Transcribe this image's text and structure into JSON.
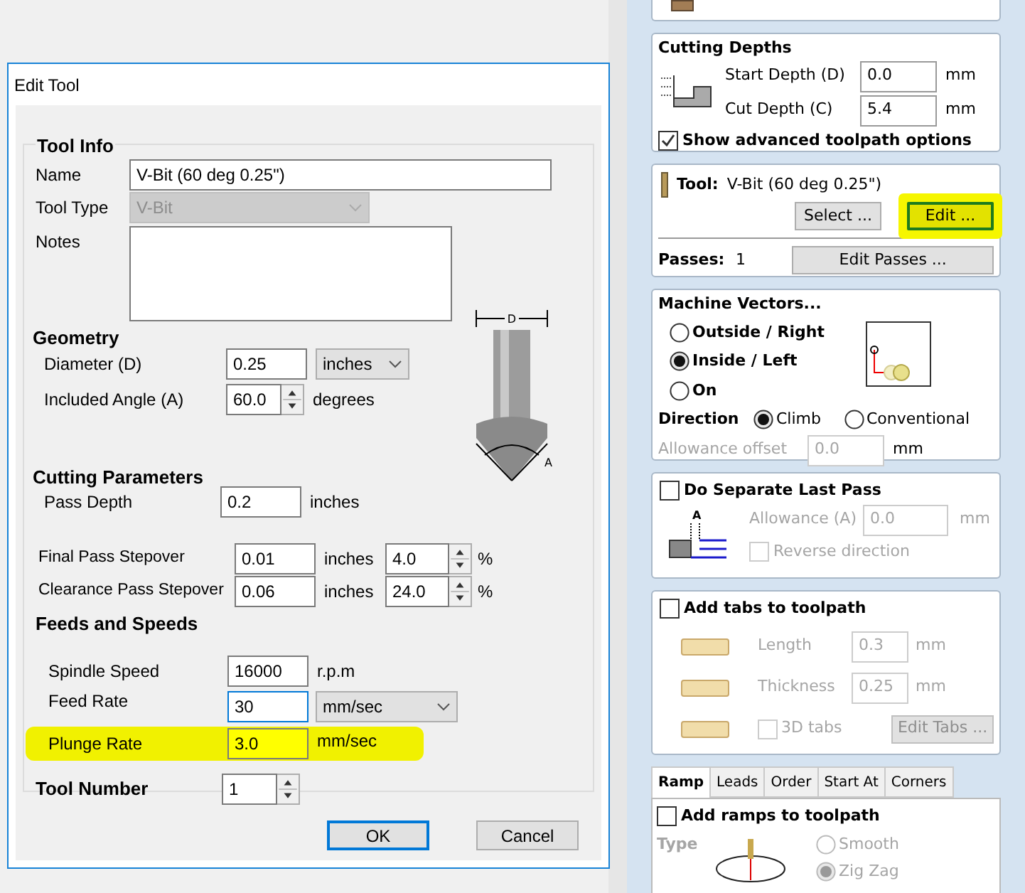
{
  "dialog": {
    "title": "Edit Tool",
    "group_title": "Tool Info",
    "name": {
      "label": "Name",
      "value": "V-Bit (60 deg 0.25\")"
    },
    "tool_type": {
      "label": "Tool Type",
      "value": "V-Bit",
      "disabled": true
    },
    "notes": {
      "label": "Notes"
    },
    "geometry": {
      "heading": "Geometry",
      "diameter": {
        "label": "Diameter (D)",
        "value": "0.25",
        "unit": "inches"
      },
      "angle": {
        "label": "Included Angle (A)",
        "value": "60.0",
        "unit": "degrees"
      }
    },
    "tool_diagram": {
      "diameter_mark": "D",
      "angle_mark": "A"
    },
    "cutting": {
      "heading": "Cutting Parameters",
      "pass_depth": {
        "label": "Pass Depth",
        "value": "0.2",
        "unit": "inches"
      },
      "stepovers": [
        {
          "label": "Final Pass Stepover",
          "value": "0.01",
          "unit": "inches",
          "percent": "4.0",
          "percent_unit": "%"
        },
        {
          "label": "Clearance Pass Stepover",
          "value": "0.06",
          "unit": "inches",
          "percent": "24.0",
          "percent_unit": "%"
        }
      ]
    },
    "feeds": {
      "heading": "Feeds and Speeds",
      "spindle": {
        "label": "Spindle Speed",
        "value": "16000",
        "unit": "r.p.m"
      },
      "feed": {
        "label": "Feed Rate",
        "value": "30",
        "unit": "mm/sec",
        "focused": true
      },
      "plunge": {
        "label": "Plunge Rate",
        "value": "3.0",
        "unit": "mm/sec",
        "highlighted": true
      }
    },
    "tool_number": {
      "label": "Tool Number",
      "value": "1"
    },
    "buttons": [
      {
        "label": "OK",
        "default": true
      },
      {
        "label": "Cancel",
        "default": false
      }
    ]
  },
  "panel": {
    "cutting_depths": {
      "title": "Cutting Depths",
      "start": {
        "label": "Start Depth (D)",
        "value": "0.0",
        "unit": "mm"
      },
      "cut": {
        "label": "Cut Depth (C)",
        "value": "5.4",
        "unit": "mm"
      },
      "show_advanced": {
        "label": "Show advanced toolpath options",
        "checked": true
      }
    },
    "tool": {
      "label": "Tool:",
      "value": "V-Bit (60 deg 0.25\")",
      "buttons": [
        {
          "label": "Select ...",
          "highlighted": false
        },
        {
          "label": "Edit ...",
          "highlighted": true
        }
      ],
      "passes_label": "Passes:",
      "passes_value": "1",
      "edit_passes": "Edit Passes ..."
    },
    "machine_vectors": {
      "title": "Machine Vectors...",
      "sides": [
        {
          "label": "Outside / Right",
          "selected": false
        },
        {
          "label": "Inside / Left",
          "selected": true
        },
        {
          "label": "On",
          "selected": false
        }
      ],
      "direction_label": "Direction",
      "directions": [
        {
          "label": "Climb",
          "selected": true
        },
        {
          "label": "Conventional",
          "selected": false
        }
      ],
      "allowance": {
        "label": "Allowance offset",
        "value": "0.0",
        "unit": "mm",
        "disabled": true
      }
    },
    "last_pass": {
      "label": "Do Separate Last Pass",
      "checked": false,
      "diagram_mark": "A",
      "allowance": {
        "label": "Allowance (A)",
        "value": "0.0",
        "unit": "mm"
      },
      "reverse": {
        "label": "Reverse direction",
        "checked": false
      }
    },
    "tabs": {
      "label": "Add tabs to toolpath",
      "checked": false,
      "length": {
        "label": "Length",
        "value": "0.3",
        "unit": "mm"
      },
      "thickness": {
        "label": "Thickness",
        "value": "0.25",
        "unit": "mm"
      },
      "tabs_3d": {
        "label": "3D tabs",
        "checked": false
      },
      "edit_button": "Edit Tabs ..."
    },
    "option_tabs": [
      {
        "label": "Ramp",
        "selected": true
      },
      {
        "label": "Leads",
        "selected": false
      },
      {
        "label": "Order",
        "selected": false
      },
      {
        "label": "Start At",
        "selected": false
      },
      {
        "label": "Corners",
        "selected": false
      }
    ],
    "ramp": {
      "label": "Add ramps to toolpath",
      "checked": false,
      "type_label": "Type",
      "types": [
        {
          "label": "Smooth",
          "selected": false
        },
        {
          "label": "Zig Zag",
          "selected": true
        }
      ]
    }
  }
}
